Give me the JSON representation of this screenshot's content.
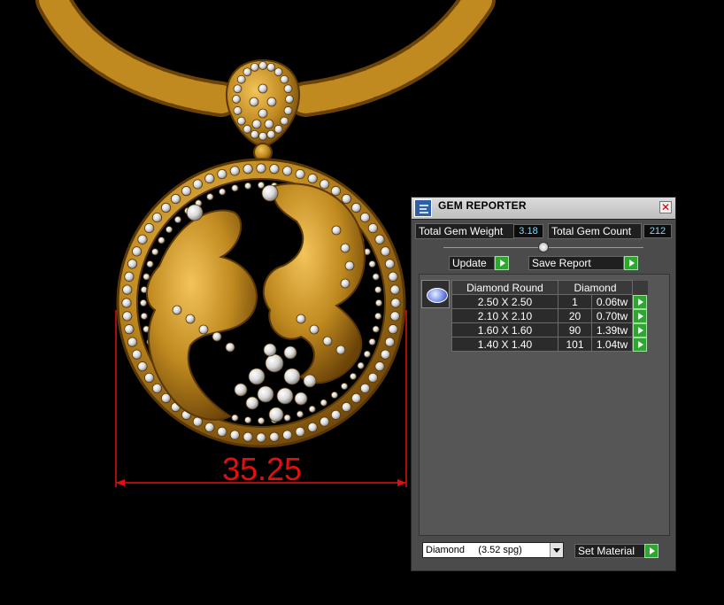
{
  "viewport": {
    "dimension_text": "35.25",
    "dimension_color": "#e01010",
    "metal_color": "#c08a20",
    "gem_color": "#e6e6e6"
  },
  "panel": {
    "title": "GEM REPORTER",
    "close_icon": "close-icon",
    "total_gem_weight_label": "Total Gem Weight",
    "total_gem_weight_value": "3.18",
    "total_gem_count_label": "Total Gem Count",
    "total_gem_count_value": "212",
    "update_label": "Update",
    "save_report_label": "Save Report",
    "table": {
      "headers": [
        "Diamond Round",
        "Diamond"
      ],
      "rows": [
        {
          "size": "2.50 X 2.50",
          "count": "1",
          "weight": "0.06tw"
        },
        {
          "size": "2.10 X 2.10",
          "count": "20",
          "weight": "0.70tw"
        },
        {
          "size": "1.60 X 1.60",
          "count": "90",
          "weight": "1.39tw"
        },
        {
          "size": "1.40 X 1.40",
          "count": "101",
          "weight": "1.04tw"
        }
      ]
    },
    "material_selected": "Diamond     (3.52 spg)",
    "set_material_label": "Set Material",
    "accent_green": "#2fa62f",
    "value_color": "#7fd9ff"
  }
}
